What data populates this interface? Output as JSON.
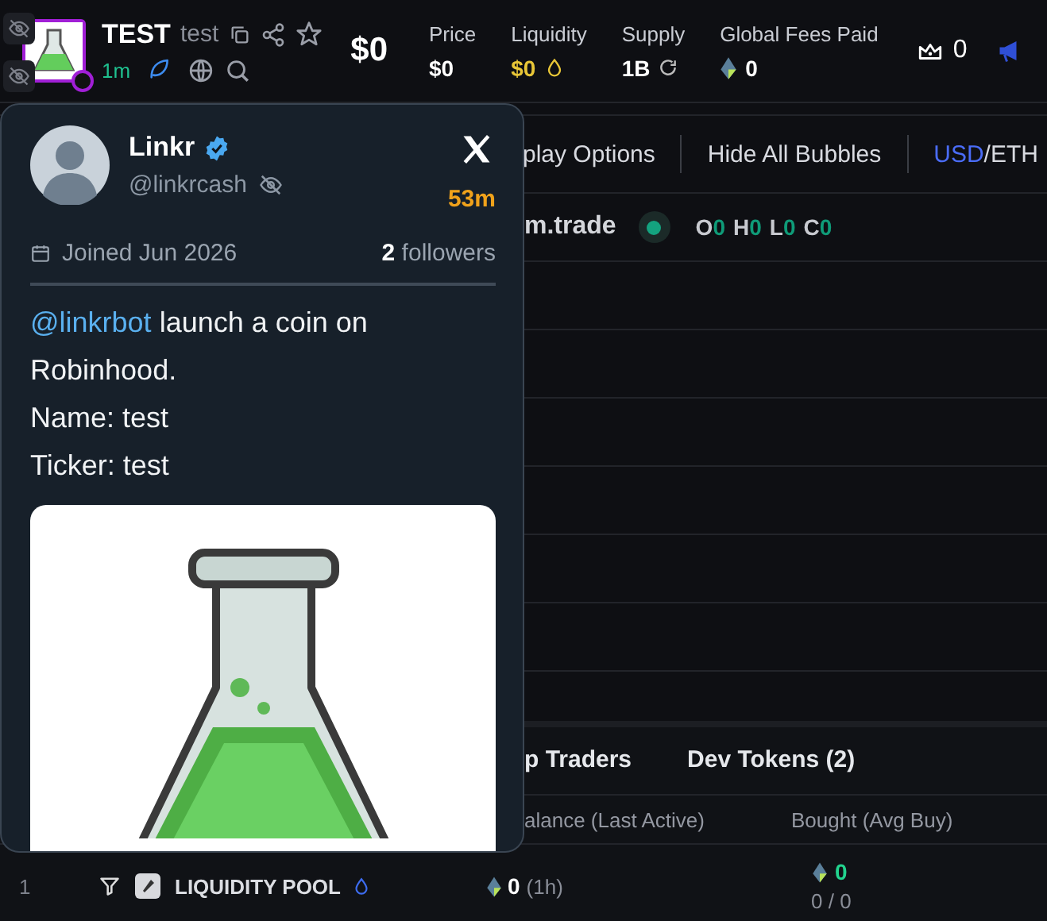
{
  "header": {
    "token_name": "TEST",
    "ticker": "test",
    "age": "1m",
    "market_cap": "$0",
    "stats": [
      {
        "label": "Price",
        "value": "$0",
        "kind": "plain"
      },
      {
        "label": "Liquidity",
        "value": "$0",
        "kind": "liquidity"
      },
      {
        "label": "Supply",
        "value": "1B",
        "kind": "supply"
      },
      {
        "label": "Global Fees Paid",
        "value": "0",
        "kind": "eth"
      }
    ],
    "crown_count": "0"
  },
  "toolbar": {
    "items": [
      "play Options",
      "Hide All Bubbles"
    ],
    "currency": [
      {
        "label": "USD",
        "selected": true
      },
      {
        "label": "ETH",
        "selected": false
      }
    ],
    "separator": "/"
  },
  "chart": {
    "title": "m.trade",
    "ohlc": [
      {
        "label": "O",
        "value": "0"
      },
      {
        "label": "H",
        "value": "0"
      },
      {
        "label": "L",
        "value": "0"
      },
      {
        "label": "C",
        "value": "0"
      }
    ]
  },
  "bottom_panel": {
    "tabs": [
      {
        "label": "p Traders",
        "selected": false
      },
      {
        "label": "Dev Tokens (2)",
        "selected": false
      }
    ],
    "columns": [
      "alance (Last Active)",
      "Bought (Avg Buy)"
    ],
    "rows": [
      {
        "rank": "1",
        "name": "LIQUIDITY POOL",
        "balance": "0",
        "last_active": "(1h)",
        "bought": "0",
        "avg_buy": "0 / 0"
      }
    ]
  },
  "profile_card": {
    "name": "Linkr",
    "verified": true,
    "handle": "@linkrcash",
    "age": "53m",
    "joined": "Joined Jun 2026",
    "followers": "**2** followers",
    "tweet": {
      "mention": "@linkrbot",
      "text": "launch a coin on Robinhood."
    },
    "lines": [
      "Name: test",
      "Ticker: test"
    ]
  }
}
